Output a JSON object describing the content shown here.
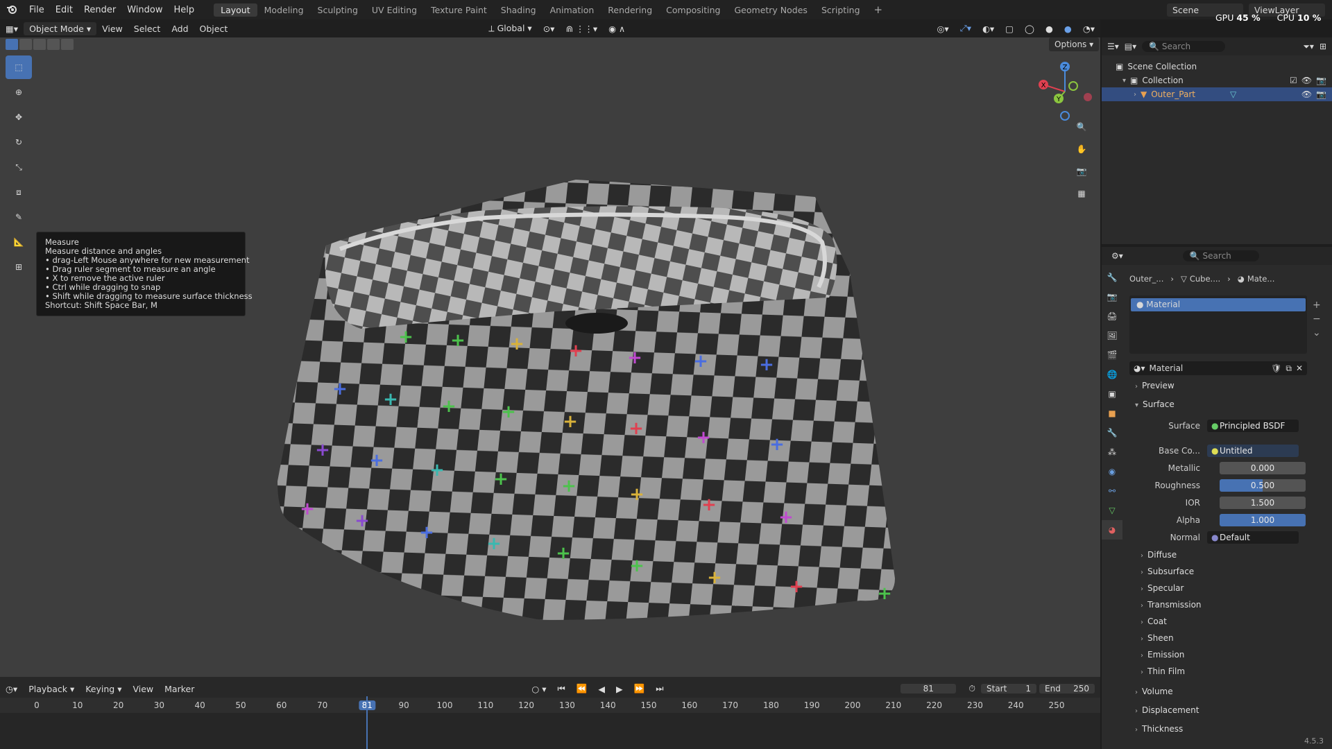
{
  "menu": {
    "items": [
      "File",
      "Edit",
      "Render",
      "Window",
      "Help"
    ]
  },
  "workspaces": [
    "Layout",
    "Modeling",
    "Sculpting",
    "UV Editing",
    "Texture Paint",
    "Shading",
    "Animation",
    "Rendering",
    "Compositing",
    "Geometry Nodes",
    "Scripting"
  ],
  "top_right": {
    "scene": "Scene",
    "view_layer": "ViewLayer",
    "gpu_label": "GPU",
    "gpu_value": "45 %",
    "cpu_label": "CPU",
    "cpu_value": "10 %"
  },
  "viewport_header": {
    "mode": "Object Mode",
    "view": "View",
    "select": "Select",
    "add": "Add",
    "object": "Object",
    "orientation": "Global",
    "options": "Options"
  },
  "tooltip": {
    "title": "Measure",
    "desc": "Measure distance and angles",
    "lines": [
      "• drag-Left Mouse anywhere for new measurement",
      "• Drag ruler segment to measure an angle",
      "• X to remove the active ruler",
      "• Ctrl while dragging to snap",
      "• Shift while dragging to measure surface thickness"
    ],
    "shortcut": "Shortcut: Shift Space Bar, M"
  },
  "gizmo": {
    "x": "X",
    "y": "Y",
    "z": "Z"
  },
  "timeline": {
    "playback": "Playback",
    "keying": "Keying",
    "view": "View",
    "marker": "Marker",
    "current_frame": "81",
    "start_label": "Start",
    "start": "1",
    "end_label": "End",
    "end": "250",
    "ticks": [
      "0",
      "10",
      "20",
      "30",
      "40",
      "50",
      "60",
      "70",
      "81",
      "90",
      "100",
      "110",
      "120",
      "130",
      "140",
      "150",
      "160",
      "170",
      "180",
      "190",
      "200",
      "210",
      "220",
      "230",
      "240",
      "250"
    ]
  },
  "outliner": {
    "search_placeholder": "Search",
    "scene_collection": "Scene Collection",
    "collection": "Collection",
    "object": "Outer_Part"
  },
  "properties": {
    "search_placeholder": "Search",
    "breadcrumb": [
      "Outer_...",
      "Cube....",
      "Mate..."
    ],
    "slot": "Material",
    "material_name": "Material",
    "panels": {
      "preview": "Preview",
      "surface": "Surface"
    },
    "surface_label": "Surface",
    "surface_value": "Principled BSDF",
    "base_color_label": "Base Co...",
    "base_color_value": "Untitled",
    "metallic_label": "Metallic",
    "metallic_value": "0.000",
    "roughness_label": "Roughness",
    "roughness_value": "0.500",
    "ior_label": "IOR",
    "ior_value": "1.500",
    "alpha_label": "Alpha",
    "alpha_value": "1.000",
    "normal_label": "Normal",
    "normal_value": "Default",
    "subpanels": [
      "Diffuse",
      "Subsurface",
      "Specular",
      "Transmission",
      "Coat",
      "Sheen",
      "Emission",
      "Thin Film"
    ],
    "bottom_panels": [
      "Volume",
      "Displacement",
      "Thickness"
    ]
  },
  "version": "4.5.3",
  "colors": {
    "accent": "#4772b3",
    "x_axis": "#e04050",
    "y_axis": "#8bc53f",
    "z_axis": "#4a8bdc"
  }
}
